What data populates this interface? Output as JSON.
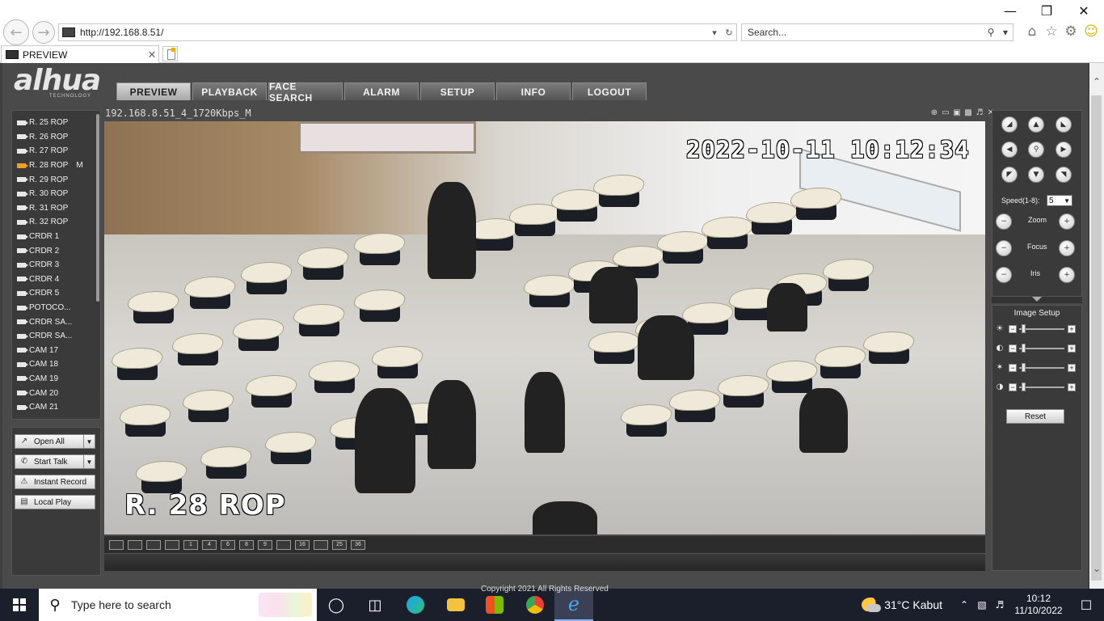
{
  "browser": {
    "url": "http://192.168.8.51/",
    "search_placeholder": "Search...",
    "tab_title": "PREVIEW"
  },
  "app": {
    "brand": "alhua",
    "brand_sub": "TECHNOLOGY",
    "nav": [
      "PREVIEW",
      "PLAYBACK",
      "FACE SEARCH",
      "ALARM",
      "SETUP",
      "INFO",
      "LOGOUT"
    ],
    "active_nav": "PREVIEW"
  },
  "cameras": [
    {
      "label": "R. 25 ROP",
      "flag": ""
    },
    {
      "label": "R. 26 ROP",
      "flag": ""
    },
    {
      "label": "R. 27 ROP",
      "flag": ""
    },
    {
      "label": "R. 28 ROP",
      "flag": "M",
      "active": true
    },
    {
      "label": "R. 29 ROP",
      "flag": ""
    },
    {
      "label": "R. 30 ROP",
      "flag": ""
    },
    {
      "label": "R. 31 ROP",
      "flag": ""
    },
    {
      "label": "R. 32 ROP",
      "flag": ""
    },
    {
      "label": "CRDR 1",
      "flag": ""
    },
    {
      "label": "CRDR 2",
      "flag": ""
    },
    {
      "label": "CRDR 3",
      "flag": ""
    },
    {
      "label": "CRDR 4",
      "flag": ""
    },
    {
      "label": "CRDR 5",
      "flag": ""
    },
    {
      "label": "POTOCO...",
      "flag": ""
    },
    {
      "label": "CRDR SA...",
      "flag": ""
    },
    {
      "label": "CRDR SA...",
      "flag": ""
    },
    {
      "label": "CAM 17",
      "flag": ""
    },
    {
      "label": "CAM 18",
      "flag": ""
    },
    {
      "label": "CAM 19",
      "flag": ""
    },
    {
      "label": "CAM 20",
      "flag": ""
    },
    {
      "label": "CAM 21",
      "flag": ""
    }
  ],
  "actions": {
    "open_all": "Open All",
    "start_talk": "Start Talk",
    "instant_record": "Instant Record",
    "local_play": "Local Play"
  },
  "video": {
    "stream_title": "192.168.8.51_4_1720Kbps_M",
    "timestamp": "2022-10-11  10:12:34",
    "channel_name": "R. 28 ROP",
    "layout_buttons": [
      "",
      "",
      "",
      "",
      "1",
      "4",
      "6",
      "8",
      "9",
      "",
      "16",
      "",
      "25",
      "36"
    ]
  },
  "ptz": {
    "speed_label": "Speed(1-8):",
    "speed_value": "5",
    "zoom_label": "Zoom",
    "focus_label": "Focus",
    "iris_label": "Iris"
  },
  "image_setup": {
    "title": "Image Setup",
    "reset_label": "Reset",
    "levels": [
      0.05,
      0.05,
      0.05,
      0.05
    ]
  },
  "footer": {
    "text": "Copyright 2021 All Rights Reserved"
  },
  "taskbar": {
    "search_placeholder": "Type here to search",
    "weather": "31°C  Kabut",
    "time": "10:12",
    "date": "11/10/2022"
  }
}
